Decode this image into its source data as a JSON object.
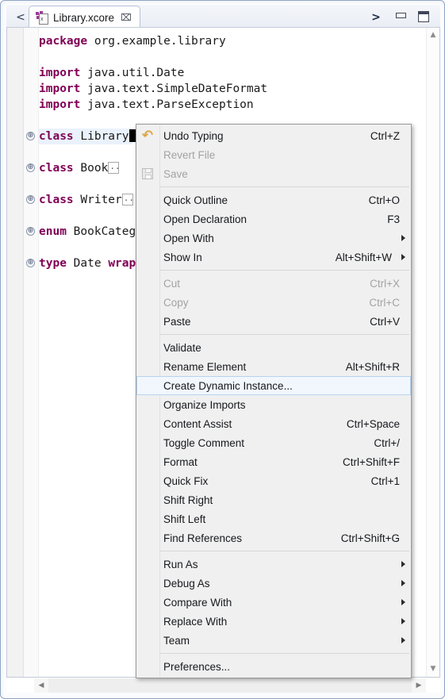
{
  "window": {
    "tab_prev_chevron": "<",
    "tab_next_chevron": ">",
    "tab_title": "Library.xcore",
    "tab_close_glyph": "⌧",
    "minimize_name": "minimize",
    "maximize_name": "maximize"
  },
  "editor": {
    "lines": [
      {
        "indent": 0,
        "segments": [
          {
            "t": "kw",
            "s": "package"
          },
          {
            "t": "n",
            "s": " org.example.library"
          }
        ],
        "fold": false
      },
      {
        "indent": 0,
        "segments": [],
        "fold": false
      },
      {
        "indent": 0,
        "segments": [
          {
            "t": "kw",
            "s": "import"
          },
          {
            "t": "n",
            "s": " java.util.Date"
          }
        ],
        "fold": false
      },
      {
        "indent": 0,
        "segments": [
          {
            "t": "kw",
            "s": "import"
          },
          {
            "t": "n",
            "s": " java.text.SimpleDateFormat"
          }
        ],
        "fold": false
      },
      {
        "indent": 0,
        "segments": [
          {
            "t": "kw",
            "s": "import"
          },
          {
            "t": "n",
            "s": " java.text.ParseException"
          }
        ],
        "fold": false
      },
      {
        "indent": 0,
        "segments": [],
        "fold": false
      },
      {
        "indent": 0,
        "segments": [
          {
            "t": "kw",
            "s": "class"
          },
          {
            "t": "n",
            "s": " Library"
          },
          {
            "t": "caret",
            "s": ""
          }
        ],
        "fold": true,
        "highlight": true
      },
      {
        "indent": 0,
        "segments": [],
        "fold": false
      },
      {
        "indent": 0,
        "segments": [
          {
            "t": "kw",
            "s": "class"
          },
          {
            "t": "n",
            "s": " Book"
          },
          {
            "t": "collapsed",
            "s": ""
          }
        ],
        "fold": true
      },
      {
        "indent": 0,
        "segments": [],
        "fold": false
      },
      {
        "indent": 0,
        "segments": [
          {
            "t": "kw",
            "s": "class"
          },
          {
            "t": "n",
            "s": " Writer"
          },
          {
            "t": "collapsed",
            "s": ""
          }
        ],
        "fold": true
      },
      {
        "indent": 0,
        "segments": [],
        "fold": false
      },
      {
        "indent": 0,
        "segments": [
          {
            "t": "kw",
            "s": "enum"
          },
          {
            "t": "n",
            "s": " BookCateg"
          }
        ],
        "fold": true
      },
      {
        "indent": 0,
        "segments": [],
        "fold": false
      },
      {
        "indent": 0,
        "segments": [
          {
            "t": "kw",
            "s": "type"
          },
          {
            "t": "n",
            "s": " Date "
          },
          {
            "t": "kw",
            "s": "wrap"
          }
        ],
        "fold": true
      }
    ],
    "vscroll_up_glyph": "▲",
    "vscroll_down_glyph": "▼",
    "hscroll_left_glyph": "◀",
    "hscroll_right_glyph": "▶"
  },
  "context_menu": {
    "groups": [
      {
        "items": [
          {
            "label": "Undo Typing",
            "accel": "Ctrl+Z",
            "disabled": false,
            "icon": "undo-icon",
            "arrow": false,
            "selected": false
          },
          {
            "label": "Revert File",
            "accel": "",
            "disabled": true,
            "icon": "",
            "arrow": false,
            "selected": false
          },
          {
            "label": "Save",
            "accel": "",
            "disabled": true,
            "icon": "save-icon",
            "arrow": false,
            "selected": false
          }
        ]
      },
      {
        "items": [
          {
            "label": "Quick Outline",
            "accel": "Ctrl+O",
            "disabled": false,
            "icon": "",
            "arrow": false,
            "selected": false
          },
          {
            "label": "Open Declaration",
            "accel": "F3",
            "disabled": false,
            "icon": "",
            "arrow": false,
            "selected": false
          },
          {
            "label": "Open With",
            "accel": "",
            "disabled": false,
            "icon": "",
            "arrow": true,
            "selected": false
          },
          {
            "label": "Show In",
            "accel": "Alt+Shift+W",
            "disabled": false,
            "icon": "",
            "arrow": true,
            "selected": false
          }
        ]
      },
      {
        "items": [
          {
            "label": "Cut",
            "accel": "Ctrl+X",
            "disabled": true,
            "icon": "",
            "arrow": false,
            "selected": false
          },
          {
            "label": "Copy",
            "accel": "Ctrl+C",
            "disabled": true,
            "icon": "",
            "arrow": false,
            "selected": false
          },
          {
            "label": "Paste",
            "accel": "Ctrl+V",
            "disabled": false,
            "icon": "",
            "arrow": false,
            "selected": false
          }
        ]
      },
      {
        "items": [
          {
            "label": "Validate",
            "accel": "",
            "disabled": false,
            "icon": "",
            "arrow": false,
            "selected": false
          },
          {
            "label": "Rename Element",
            "accel": "Alt+Shift+R",
            "disabled": false,
            "icon": "",
            "arrow": false,
            "selected": false
          },
          {
            "label": "Create Dynamic Instance...",
            "accel": "",
            "disabled": false,
            "icon": "",
            "arrow": false,
            "selected": true
          },
          {
            "label": "Organize Imports",
            "accel": "",
            "disabled": false,
            "icon": "",
            "arrow": false,
            "selected": false
          },
          {
            "label": "Content Assist",
            "accel": "Ctrl+Space",
            "disabled": false,
            "icon": "",
            "arrow": false,
            "selected": false
          },
          {
            "label": "Toggle Comment",
            "accel": "Ctrl+/",
            "disabled": false,
            "icon": "",
            "arrow": false,
            "selected": false
          },
          {
            "label": "Format",
            "accel": "Ctrl+Shift+F",
            "disabled": false,
            "icon": "",
            "arrow": false,
            "selected": false
          },
          {
            "label": "Quick Fix",
            "accel": "Ctrl+1",
            "disabled": false,
            "icon": "",
            "arrow": false,
            "selected": false
          },
          {
            "label": "Shift Right",
            "accel": "",
            "disabled": false,
            "icon": "",
            "arrow": false,
            "selected": false
          },
          {
            "label": "Shift Left",
            "accel": "",
            "disabled": false,
            "icon": "",
            "arrow": false,
            "selected": false
          },
          {
            "label": "Find References",
            "accel": "Ctrl+Shift+G",
            "disabled": false,
            "icon": "",
            "arrow": false,
            "selected": false
          }
        ]
      },
      {
        "items": [
          {
            "label": "Run As",
            "accel": "",
            "disabled": false,
            "icon": "",
            "arrow": true,
            "selected": false
          },
          {
            "label": "Debug As",
            "accel": "",
            "disabled": false,
            "icon": "",
            "arrow": true,
            "selected": false
          },
          {
            "label": "Compare With",
            "accel": "",
            "disabled": false,
            "icon": "",
            "arrow": true,
            "selected": false
          },
          {
            "label": "Replace With",
            "accel": "",
            "disabled": false,
            "icon": "",
            "arrow": true,
            "selected": false
          },
          {
            "label": "Team",
            "accel": "",
            "disabled": false,
            "icon": "",
            "arrow": true,
            "selected": false
          }
        ]
      },
      {
        "items": [
          {
            "label": "Preferences...",
            "accel": "",
            "disabled": false,
            "icon": "",
            "arrow": false,
            "selected": false
          }
        ]
      }
    ]
  },
  "colors": {
    "keyword": "#7f0055",
    "menu_bg": "#f0f0f0",
    "selection": "#f2f7fd",
    "selection_border": "#b6d3ef",
    "line_highlight": "#eaf2fb",
    "tab_icon": "#a0379a"
  }
}
